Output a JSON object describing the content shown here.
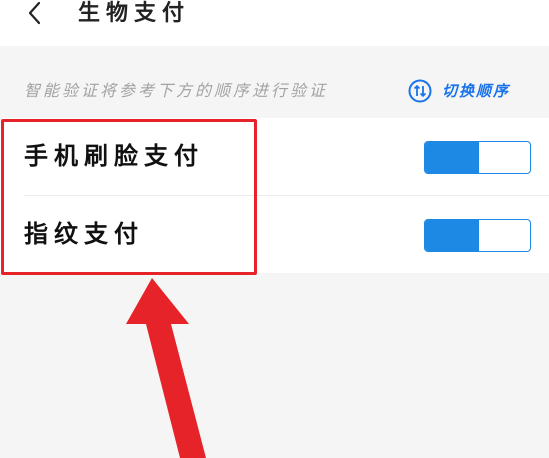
{
  "header": {
    "title": "生物支付",
    "back_icon": "chevron-left-icon"
  },
  "hint": {
    "text": "智能验证将参考下方的顺序进行验证",
    "switch_order_icon": "swap-order-icon",
    "switch_order_label": "切换顺序",
    "accent_color": "#1a73e8"
  },
  "options": [
    {
      "label": "手机刷脸支付",
      "enabled": true
    },
    {
      "label": "指纹支付",
      "enabled": true
    }
  ],
  "annotation": {
    "highlight_color": "#e62329",
    "arrow": "annotation-arrow"
  },
  "colors": {
    "toggle_on": "#1e88e5",
    "page_bg": "#f5f5f5",
    "card_bg": "#ffffff"
  }
}
